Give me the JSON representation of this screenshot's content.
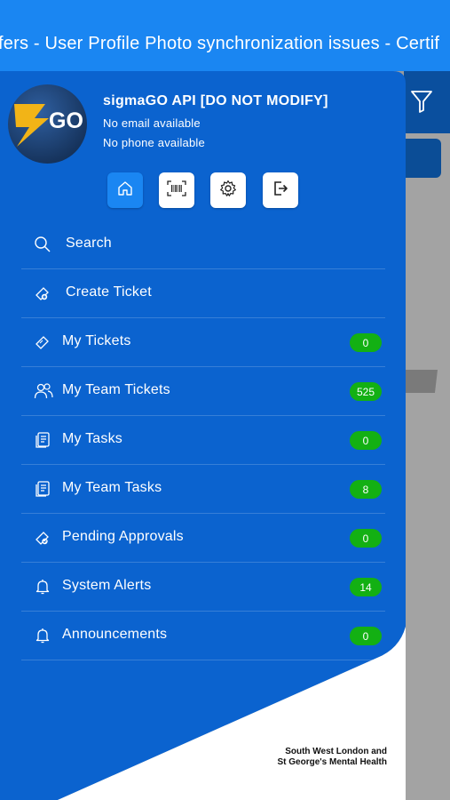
{
  "ticker": {
    "text": "fers   - User Profile Photo synchronization issues - Certif"
  },
  "profile": {
    "name": "sigmaGO API [DO NOT MODIFY]",
    "email": "No email available",
    "phone": "No phone available",
    "logo_text": "GO"
  },
  "quick_actions": [
    {
      "icon": "home-icon"
    },
    {
      "icon": "barcode-icon"
    },
    {
      "icon": "gear-icon"
    },
    {
      "icon": "logout-icon"
    }
  ],
  "menu": {
    "items": [
      {
        "label": "Search",
        "icon": "search-icon"
      },
      {
        "label": "Create Ticket",
        "icon": "ticket-add-icon"
      },
      {
        "label": "My Tickets",
        "icon": "ticket-icon",
        "count": "0"
      },
      {
        "label": "My Team Tickets",
        "icon": "team-icon",
        "count": "525"
      },
      {
        "label": "My Tasks",
        "icon": "tasks-icon",
        "count": "0"
      },
      {
        "label": "My Team Tasks",
        "icon": "tasks-icon",
        "count": "8"
      },
      {
        "label": "Pending Approvals",
        "icon": "ticket-approval-icon",
        "count": "0"
      },
      {
        "label": "System Alerts",
        "icon": "bell-icon",
        "count": "14"
      },
      {
        "label": "Announcements",
        "icon": "bell-icon",
        "count": "0"
      }
    ]
  },
  "organization": {
    "line1": "South West London and",
    "line2": "St George's Mental Health"
  },
  "colors": {
    "drawer_blue": "#0b63cf",
    "ticker_blue": "#1a86f2",
    "badge_green": "#13b013"
  }
}
